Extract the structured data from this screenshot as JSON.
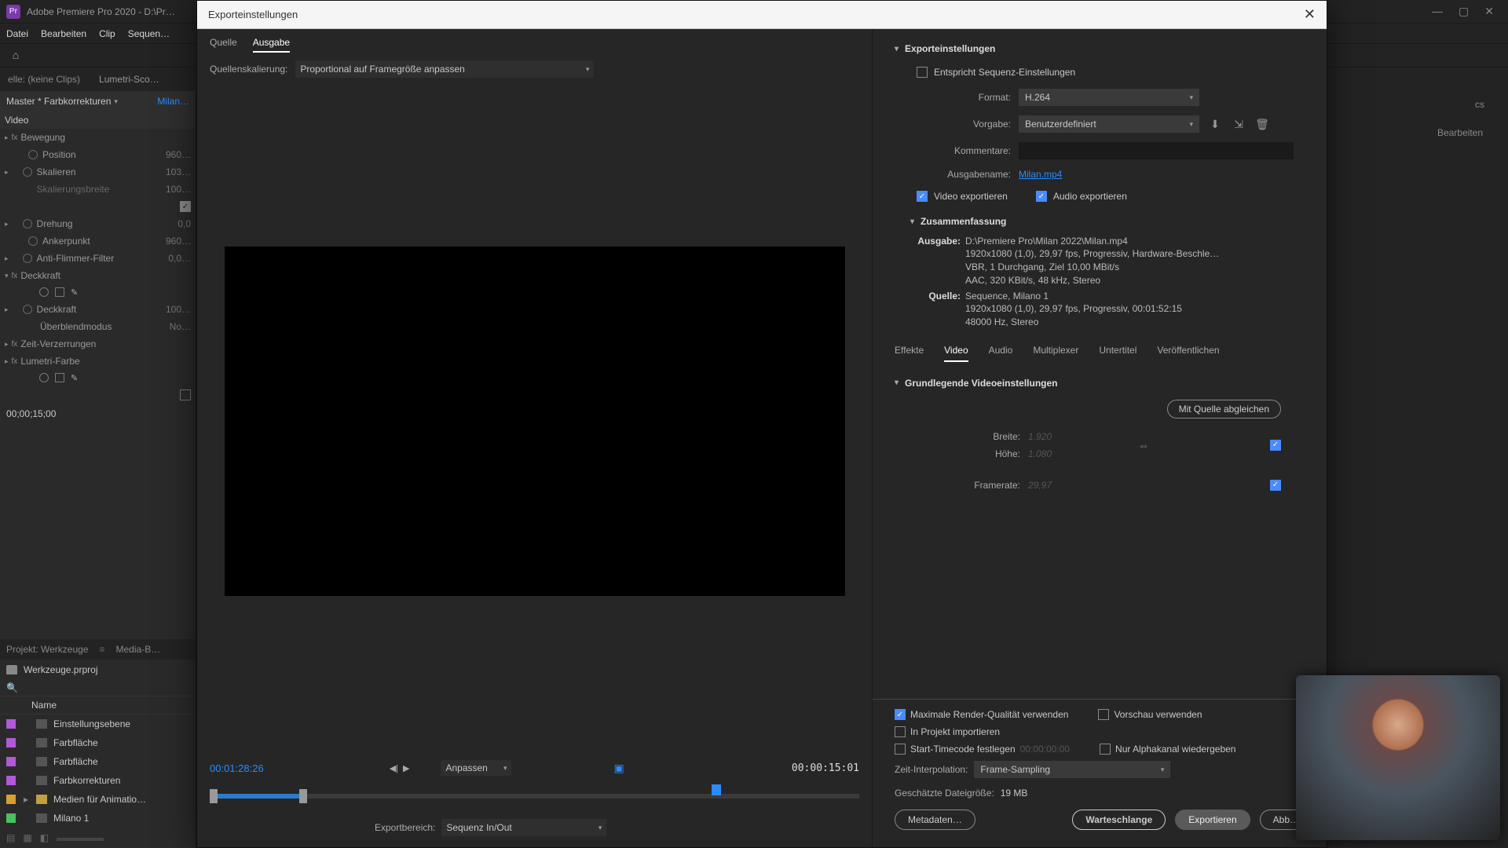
{
  "titlebar": {
    "app": "Adobe Premiere Pro 2020 - D:\\Pr…"
  },
  "menu": [
    "Datei",
    "Bearbeiten",
    "Clip",
    "Sequen…"
  ],
  "subtabs": {
    "none": "elle: (keine Clips)",
    "lumetri": "Lumetri-Sco…"
  },
  "fx": {
    "master": "Master * Farbkorrekturen",
    "clip": "Milan…",
    "video": "Video",
    "motion": "Bewegung",
    "position": "Position",
    "position_v": "960…",
    "scale": "Skalieren",
    "scale_v": "103…",
    "scalew": "Skalierungsbreite",
    "scalew_v": "100…",
    "rotation": "Drehung",
    "rotation_v": "0,0",
    "anchor": "Ankerpunkt",
    "anchor_v": "960…",
    "antifl": "Anti-Flimmer-Filter",
    "antifl_v": "0,0…",
    "opacity_sec": "Deckkraft",
    "opacity": "Deckkraft",
    "opacity_v": "100…",
    "blend": "Überblendmodus",
    "blend_v": "No…",
    "timeremap": "Zeit-Verzerrungen",
    "lumetri": "Lumetri-Farbe",
    "tc": "00;00;15;00"
  },
  "project": {
    "tab1": "Projekt: Werkzeuge",
    "tab2": "Media-B…",
    "file": "Werkzeuge.prproj",
    "header": "Name",
    "items": [
      {
        "color": "#b05ad8",
        "name": "Einstellungsebene"
      },
      {
        "color": "#b05ad8",
        "name": "Farbfläche"
      },
      {
        "color": "#b05ad8",
        "name": "Farbfläche"
      },
      {
        "color": "#b05ad8",
        "name": "Farbkorrekturen"
      },
      {
        "color": "#d8a030",
        "name": "Medien für Animatio…",
        "folder": true
      },
      {
        "color": "#4ac060",
        "name": "Milano 1"
      }
    ]
  },
  "rightArea": {
    "tab": "cs",
    "edit": "Bearbeiten"
  },
  "export": {
    "title": "Exporteinstellungen",
    "leftTabs": {
      "source": "Quelle",
      "output": "Ausgabe"
    },
    "scaleLabel": "Quellenskalierung:",
    "scaleValue": "Proportional auf Framegröße anpassen",
    "tcLeft": "00:01:28:26",
    "fitLabel": "Anpassen",
    "tcRight": "00:00:15:01",
    "rangeLabel": "Exportbereich:",
    "rangeValue": "Sequenz In/Out",
    "settingsHead": "Exporteinstellungen",
    "matchSeq": "Entspricht Sequenz-Einstellungen",
    "formatLabel": "Format:",
    "formatValue": "H.264",
    "presetLabel": "Vorgabe:",
    "presetValue": "Benutzerdefiniert",
    "commentsLabel": "Kommentare:",
    "outNameLabel": "Ausgabename:",
    "outNameValue": "Milan.mp4",
    "exportVideo": "Video exportieren",
    "exportAudio": "Audio exportieren",
    "summaryHead": "Zusammenfassung",
    "summary": {
      "outLabel": "Ausgabe:",
      "outPath": "D:\\Premiere Pro\\Milan 2022\\Milan.mp4",
      "outLine2": "1920x1080 (1,0), 29,97 fps, Progressiv, Hardware-Beschle…",
      "outLine3": "VBR, 1 Durchgang, Ziel 10,00 MBit/s",
      "outLine4": "AAC, 320 KBit/s, 48 kHz, Stereo",
      "srcLabel": "Quelle:",
      "srcLine1": "Sequence, Milano 1",
      "srcLine2": "1920x1080 (1,0), 29,97 fps, Progressiv, 00:01:52:15",
      "srcLine3": "48000 Hz, Stereo"
    },
    "tabs": [
      "Effekte",
      "Video",
      "Audio",
      "Multiplexer",
      "Untertitel",
      "Veröffentlichen"
    ],
    "basicVideo": "Grundlegende Videoeinstellungen",
    "matchSource": "Mit Quelle abgleichen",
    "widthLabel": "Breite:",
    "widthValue": "1.920",
    "heightLabel": "Höhe:",
    "heightValue": "1.080",
    "fpsLabel": "Framerate:",
    "fpsValue": "29,97",
    "maxRender": "Maximale Render-Qualität verwenden",
    "usePreview": "Vorschau verwenden",
    "importProj": "In Projekt importieren",
    "startTC": "Start-Timecode festlegen",
    "startTCVal": "00:00:00:00",
    "alphaOnly": "Nur Alphakanal wiedergeben",
    "timeInterpLabel": "Zeit-Interpolation:",
    "timeInterpValue": "Frame-Sampling",
    "fileSizeLabel": "Geschätzte Dateigröße:",
    "fileSizeValue": "19 MB",
    "btnMetadata": "Metadaten…",
    "btnQueue": "Warteschlange",
    "btnExport": "Exportieren",
    "btnCancel": "Abb…"
  }
}
